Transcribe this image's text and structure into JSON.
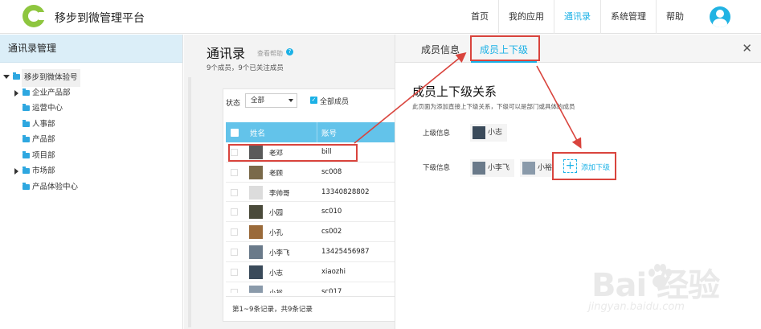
{
  "header": {
    "app_title": "移步到微管理平台",
    "nav": [
      "首页",
      "我的应用",
      "通讯录",
      "系统管理",
      "帮助"
    ],
    "active_nav": "通讯录"
  },
  "sidebar": {
    "title": "通讯录管理",
    "tree": [
      {
        "label": "移步到微体验号",
        "level": 0,
        "expand": "down"
      },
      {
        "label": "企业产品部",
        "level": 1,
        "expand": "right"
      },
      {
        "label": "运营中心",
        "level": 1,
        "expand": ""
      },
      {
        "label": "人事部",
        "level": 1,
        "expand": ""
      },
      {
        "label": "产品部",
        "level": 1,
        "expand": ""
      },
      {
        "label": "项目部",
        "level": 1,
        "expand": ""
      },
      {
        "label": "市场部",
        "level": 1,
        "expand": "right"
      },
      {
        "label": "产品体验中心",
        "level": 1,
        "expand": ""
      }
    ]
  },
  "contacts": {
    "title": "通讯录",
    "help_link": "查看帮助",
    "summary": "9个成员，9个已关注成员",
    "status_label": "状态",
    "status_value": "全部",
    "all_members_label": "全部成员",
    "col_name": "姓名",
    "col_account": "账号",
    "rows": [
      {
        "name": "老邓",
        "account": "bill",
        "highlight": true
      },
      {
        "name": "老顾",
        "account": "sc008",
        "highlight": false
      },
      {
        "name": "李帅哥",
        "account": "13340828802",
        "highlight": false
      },
      {
        "name": "小园",
        "account": "sc010",
        "highlight": false
      },
      {
        "name": "小孔",
        "account": "cs002",
        "highlight": false
      },
      {
        "name": "小李飞",
        "account": "13425456987",
        "highlight": false
      },
      {
        "name": "小志",
        "account": "xiaozhi",
        "highlight": false
      },
      {
        "name": "小裕",
        "account": "sc017",
        "highlight": false
      }
    ],
    "pager": "第1~9条记录，共9条记录"
  },
  "detail": {
    "tab_info": "成员信息",
    "tab_relation": "成员上下级",
    "close": "✕",
    "relation_title": "成员上下级关系",
    "relation_desc": "此页面为添加直接上下级关系，下级可以是部门或具体的成员",
    "superior_label": "上级信息",
    "superior": "小志",
    "subordinate_label": "下级信息",
    "subordinates": [
      "小李飞",
      "小裕"
    ],
    "add_subordinate": "添加下级"
  },
  "watermark": {
    "brand": "Bai  经验",
    "url": "jingyan.baidu.com"
  },
  "colors": {
    "accent": "#1bb1e6",
    "highlight_box": "#d9443d",
    "table_header": "#63c3ea",
    "sidebar_title_bg": "#dbeef8"
  }
}
